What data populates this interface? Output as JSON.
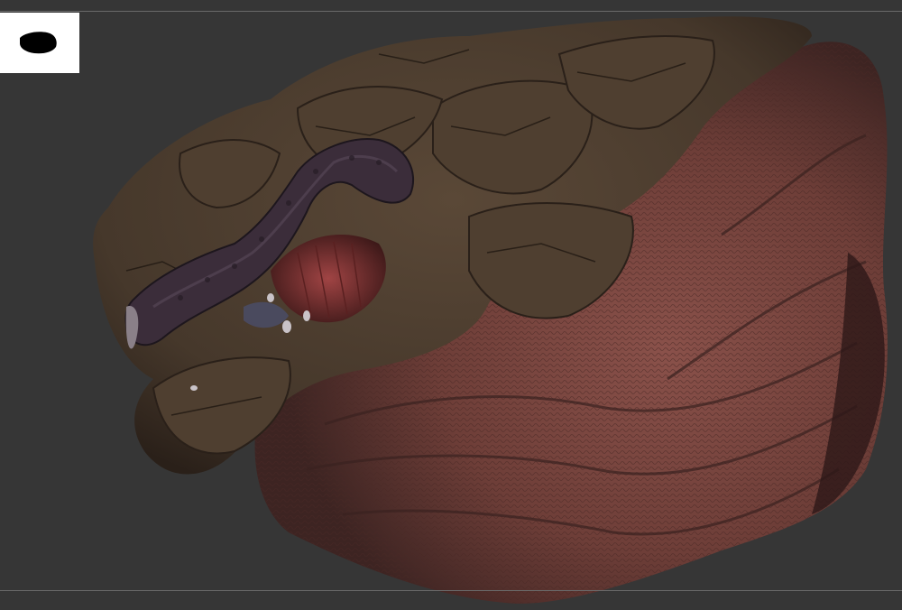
{
  "app": {
    "kind": "3d-sculpt-viewport"
  },
  "viewport": {
    "background_color": "#363636",
    "rule_color": "#6a6a6a"
  },
  "navigator": {
    "icon": "silhouette-thumbnail-icon",
    "background_color": "#ffffff",
    "silhouette_color": "#000000"
  },
  "model": {
    "icon": "creature-head-sculpt",
    "colors": {
      "bark": "#4a3a2c",
      "bark_dark": "#2a2019",
      "flesh": "#6e3e38",
      "flesh_light": "#8a514a",
      "mouth": "#7a2f2f",
      "tentacle": "#3b2d3a",
      "teeth": "#c9c3c8"
    }
  }
}
